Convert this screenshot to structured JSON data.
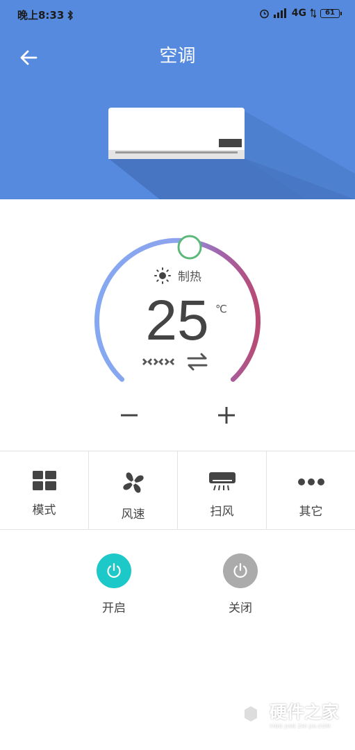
{
  "status_bar": {
    "time": "晚上8:33",
    "network": "4G",
    "battery": "61"
  },
  "header": {
    "title": "空调"
  },
  "thermostat": {
    "mode_label": "制热",
    "temperature": "25",
    "unit": "℃"
  },
  "functions": [
    {
      "label": "模式",
      "icon": "mode-grid-icon"
    },
    {
      "label": "风速",
      "icon": "fan-icon"
    },
    {
      "label": "扫风",
      "icon": "swing-icon"
    },
    {
      "label": "其它",
      "icon": "more-icon"
    }
  ],
  "power": {
    "on_label": "开启",
    "off_label": "关闭",
    "on_color": "#1DC8C8",
    "off_color": "#ABABAB"
  },
  "watermark": {
    "main": "硬件之家",
    "sub": "YING JIAN ZHI JIA.COM"
  },
  "colors": {
    "header_bg": "#558ADF",
    "arc_start": "#85A8F0",
    "arc_end": "#B84A72",
    "knob_border": "#5CB87A"
  }
}
